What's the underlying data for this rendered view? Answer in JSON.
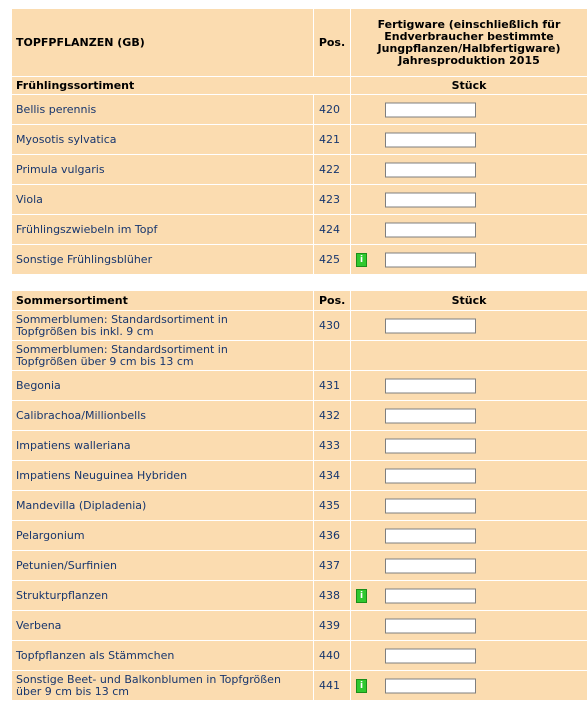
{
  "table1": {
    "header": {
      "title": "TOPFPFLANZEN (GB)",
      "pos": "Pos.",
      "col3_lines": [
        "Fertigware (einschließlich für",
        "Endverbraucher bestimmte",
        "Jungpflanzen/Halbfertigware)",
        "Jahresproduktion 2015"
      ]
    },
    "section": {
      "title": "Frühlingssortiment",
      "unit": "Stück"
    },
    "rows": [
      {
        "name": "Bellis perennis",
        "pos": "420",
        "value": ""
      },
      {
        "name": "Myosotis sylvatica",
        "pos": "421",
        "value": ""
      },
      {
        "name": "Primula vulgaris",
        "pos": "422",
        "value": ""
      },
      {
        "name": "Viola",
        "pos": "423",
        "value": ""
      },
      {
        "name": "Frühlingszwiebeln im Topf",
        "pos": "424",
        "value": ""
      },
      {
        "name": "Sonstige Frühlingsblüher",
        "pos": "425",
        "value": "",
        "info": "i"
      }
    ]
  },
  "table2": {
    "section": {
      "title": "Sommersortiment",
      "pos": "Pos.",
      "unit": "Stück"
    },
    "rows": [
      {
        "name_lines": [
          "Sommerblumen: Standardsortiment in",
          "Topfgrößen bis inkl. 9 cm"
        ],
        "pos": "430",
        "value": ""
      },
      {
        "name_lines": [
          "Sommerblumen: Standardsortiment in",
          "Topfgrößen über 9 cm bis 13 cm"
        ],
        "pos": ""
      },
      {
        "name": "Begonia",
        "pos": "431",
        "value": ""
      },
      {
        "name": "Calibrachoa/Millionbells",
        "pos": "432",
        "value": ""
      },
      {
        "name": "Impatiens walleriana",
        "pos": "433",
        "value": ""
      },
      {
        "name": "Impatiens Neuguinea Hybriden",
        "pos": "434",
        "value": ""
      },
      {
        "name": "Mandevilla (Dipladenia)",
        "pos": "435",
        "value": ""
      },
      {
        "name": "Pelargonium",
        "pos": "436",
        "value": ""
      },
      {
        "name": "Petunien/Surfinien",
        "pos": "437",
        "value": ""
      },
      {
        "name": "Strukturpflanzen",
        "pos": "438",
        "value": "",
        "info": "i"
      },
      {
        "name": "Verbena",
        "pos": "439",
        "value": ""
      },
      {
        "name": "Topfpflanzen als Stämmchen",
        "pos": "440",
        "value": ""
      },
      {
        "name_lines": [
          "Sonstige Beet- und Balkonblumen in Topfgrößen",
          "über 9 cm bis 13 cm"
        ],
        "pos": "441",
        "value": "",
        "info": "i"
      }
    ]
  },
  "colors": {
    "row_bg": "#fbdcb0",
    "text": "#17366e",
    "info_badge": "#2fc82f"
  }
}
